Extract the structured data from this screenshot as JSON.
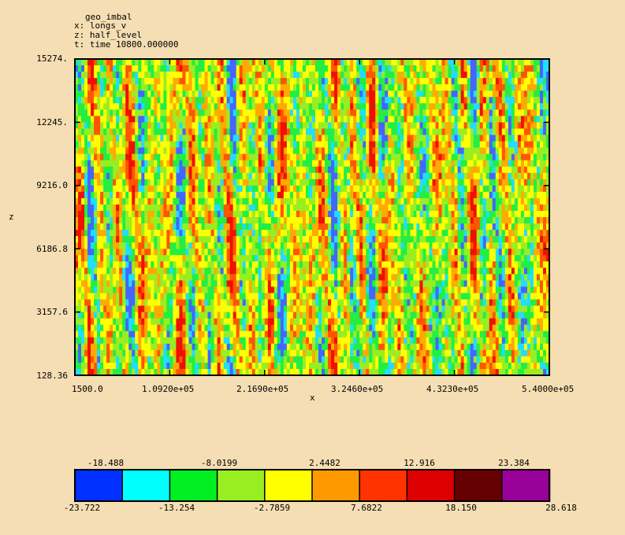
{
  "header": {
    "title": "geo_imbal",
    "x_line": "x: longs_v",
    "z_line": "z: half_level",
    "t_line": "t: time 10800.000000"
  },
  "chart_data": {
    "type": "heatmap",
    "variable": "geo_imbal",
    "xlabel": "x",
    "ylabel": "z",
    "xlim": [
      1500.0,
      540000.0
    ],
    "ylim": [
      128.36,
      15274.0
    ],
    "x_ticks": [
      "1500.0",
      "1.0920e+05",
      "2.1690e+05",
      "3.2460e+05",
      "4.3230e+05",
      "5.4000e+05"
    ],
    "y_ticks": [
      "15274.",
      "12245.",
      "9216.0",
      "6186.8",
      "3157.6",
      "128.36"
    ],
    "colorbar": {
      "vmin": -23.722,
      "vmax": 28.618,
      "upper_labels": [
        "-18.488",
        "-8.0199",
        "2.4482",
        "12.916",
        "23.384"
      ],
      "lower_labels": [
        "-23.722",
        "-13.254",
        "-2.7859",
        "7.6822",
        "18.150",
        "28.618"
      ],
      "colors": [
        "#0030ff",
        "#00ffff",
        "#00ee22",
        "#99ee22",
        "#ffff00",
        "#ff9900",
        "#ff3300",
        "#dd0000",
        "#660000",
        "#990099"
      ]
    },
    "field_colors": [
      "#4466ff",
      "#22ddff",
      "#22ee44",
      "#99ee22",
      "#ffff00",
      "#ffaa00",
      "#ff5500",
      "#ee1100"
    ]
  }
}
